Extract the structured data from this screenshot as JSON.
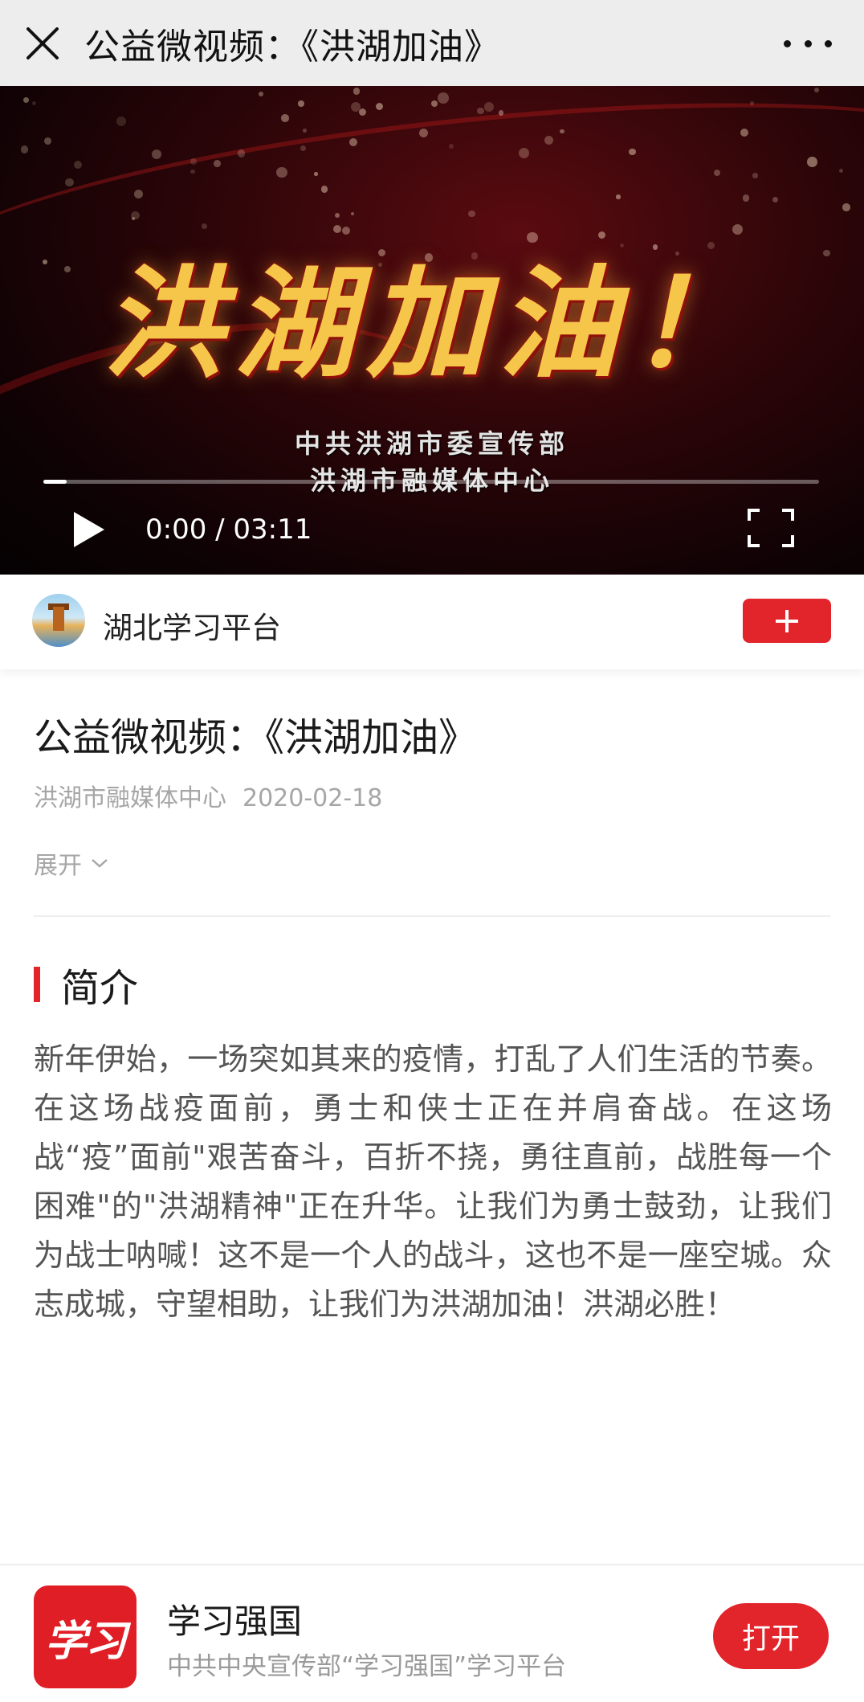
{
  "navbar": {
    "title": "公益微视频：《洪湖加油》"
  },
  "video": {
    "headline": "洪湖加油！",
    "credit_line1": "中共洪湖市委宣传部",
    "credit_line2": "洪湖市融媒体中心",
    "time_display": "0:00 / 03:11",
    "progress": 0.03
  },
  "author": {
    "name": "湖北学习平台"
  },
  "article": {
    "title": "公益微视频：《洪湖加油》",
    "source": "洪湖市融媒体中心",
    "date": "2020-02-18",
    "expand_label": "展开"
  },
  "intro": {
    "heading": "简介",
    "text": "新年伊始，一场突如其来的疫情，打乱了人们生活的节奏。在这场战疫面前，勇士和侠士正在并肩奋战。在这场战“疫”面前\"艰苦奋斗，百折不挠，勇往直前，战胜每一个困难\"的\"洪湖精神\"正在升华。让我们为勇士鼓劲，让我们为战士呐喊！这不是一个人的战斗，这也不是一座空城。众志成城，守望相助，让我们为洪湖加油！洪湖必胜！"
  },
  "app_banner": {
    "logo_text": "学习",
    "name": "学习强国",
    "description": "中共中央宣传部“学习强国”学习平台",
    "open_label": "打开"
  },
  "colors": {
    "accent": "#e2242b",
    "nav_bg": "#ededed",
    "meta_text": "#a6a6a6"
  },
  "icons": {
    "close": "close-icon",
    "more": "more-icon",
    "play": "play-icon",
    "fullscreen": "fullscreen-icon",
    "follow": "plus-icon",
    "expand": "chevron-down-icon"
  }
}
